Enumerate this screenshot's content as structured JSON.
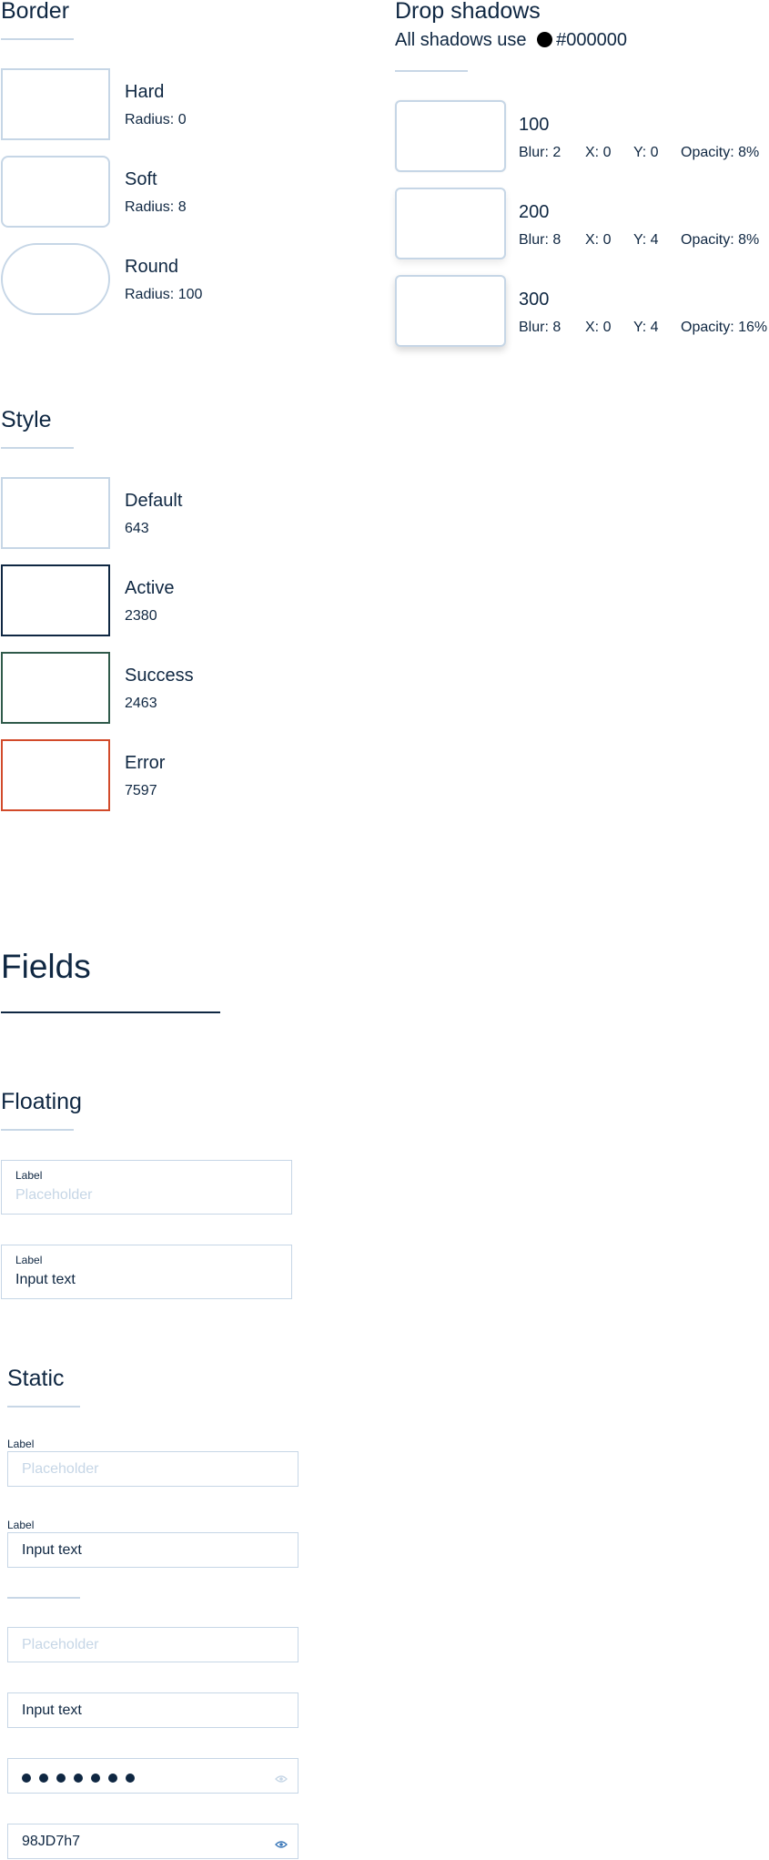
{
  "border": {
    "title": "Border",
    "items": [
      {
        "label": "Hard",
        "sub": "Radius: 0"
      },
      {
        "label": "Soft",
        "sub": "Radius: 8"
      },
      {
        "label": "Round",
        "sub": "Radius: 100"
      }
    ]
  },
  "shadows": {
    "title": "Drop shadows",
    "subtitle_prefix": "All shadows use",
    "color_code": "#000000",
    "items": [
      {
        "label": "100",
        "blur": "Blur: 2",
        "x": "X: 0",
        "y": "Y: 0",
        "opacity": "Opacity: 8%"
      },
      {
        "label": "200",
        "blur": "Blur: 8",
        "x": "X: 0",
        "y": "Y: 4",
        "opacity": "Opacity: 8%"
      },
      {
        "label": "300",
        "blur": "Blur: 8",
        "x": "X: 0",
        "y": "Y: 4",
        "opacity": "Opacity: 16%"
      }
    ]
  },
  "style": {
    "title": "Style",
    "items": [
      {
        "label": "Default",
        "sub": "643",
        "color": "#c6d6e6"
      },
      {
        "label": "Active",
        "sub": "2380",
        "color": "#0f2742"
      },
      {
        "label": "Success",
        "sub": "2463",
        "color": "#2f5a4a"
      },
      {
        "label": "Error",
        "sub": "7597",
        "color": "#d24a2a"
      }
    ]
  },
  "fields": {
    "title": "Fields",
    "floating": {
      "title": "Floating",
      "empty": {
        "label": "Label",
        "placeholder": "Placeholder"
      },
      "filled": {
        "label": "Label",
        "value": "Input text"
      }
    },
    "static": {
      "title": "Static",
      "empty": {
        "label": "Label",
        "placeholder": "Placeholder"
      },
      "filled": {
        "label": "Label",
        "value": "Input text"
      },
      "nolabel_empty": {
        "placeholder": "Placeholder"
      },
      "nolabel_filled": {
        "value": "Input text"
      },
      "password_hidden": {
        "dots": 7,
        "icon": "eye-icon"
      },
      "password_shown": {
        "value": "98JD7h7",
        "icon": "eye-icon"
      }
    }
  },
  "colors": {
    "text": "#0f2742",
    "border_default": "#c6d6e6",
    "placeholder": "#c6d6e6"
  }
}
